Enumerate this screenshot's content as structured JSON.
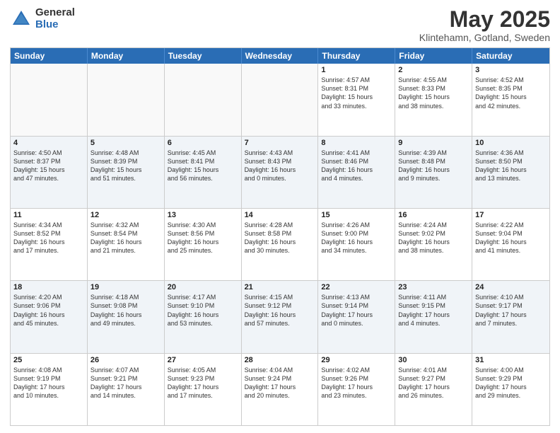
{
  "header": {
    "logo_general": "General",
    "logo_blue": "Blue",
    "title": "May 2025",
    "location": "Klintehamn, Gotland, Sweden"
  },
  "weekdays": [
    "Sunday",
    "Monday",
    "Tuesday",
    "Wednesday",
    "Thursday",
    "Friday",
    "Saturday"
  ],
  "weeks": [
    [
      {
        "day": "",
        "info": "",
        "empty": true
      },
      {
        "day": "",
        "info": "",
        "empty": true
      },
      {
        "day": "",
        "info": "",
        "empty": true
      },
      {
        "day": "",
        "info": "",
        "empty": true
      },
      {
        "day": "1",
        "info": "Sunrise: 4:57 AM\nSunset: 8:31 PM\nDaylight: 15 hours\nand 33 minutes.",
        "empty": false
      },
      {
        "day": "2",
        "info": "Sunrise: 4:55 AM\nSunset: 8:33 PM\nDaylight: 15 hours\nand 38 minutes.",
        "empty": false
      },
      {
        "day": "3",
        "info": "Sunrise: 4:52 AM\nSunset: 8:35 PM\nDaylight: 15 hours\nand 42 minutes.",
        "empty": false
      }
    ],
    [
      {
        "day": "4",
        "info": "Sunrise: 4:50 AM\nSunset: 8:37 PM\nDaylight: 15 hours\nand 47 minutes.",
        "empty": false
      },
      {
        "day": "5",
        "info": "Sunrise: 4:48 AM\nSunset: 8:39 PM\nDaylight: 15 hours\nand 51 minutes.",
        "empty": false
      },
      {
        "day": "6",
        "info": "Sunrise: 4:45 AM\nSunset: 8:41 PM\nDaylight: 15 hours\nand 56 minutes.",
        "empty": false
      },
      {
        "day": "7",
        "info": "Sunrise: 4:43 AM\nSunset: 8:43 PM\nDaylight: 16 hours\nand 0 minutes.",
        "empty": false
      },
      {
        "day": "8",
        "info": "Sunrise: 4:41 AM\nSunset: 8:46 PM\nDaylight: 16 hours\nand 4 minutes.",
        "empty": false
      },
      {
        "day": "9",
        "info": "Sunrise: 4:39 AM\nSunset: 8:48 PM\nDaylight: 16 hours\nand 9 minutes.",
        "empty": false
      },
      {
        "day": "10",
        "info": "Sunrise: 4:36 AM\nSunset: 8:50 PM\nDaylight: 16 hours\nand 13 minutes.",
        "empty": false
      }
    ],
    [
      {
        "day": "11",
        "info": "Sunrise: 4:34 AM\nSunset: 8:52 PM\nDaylight: 16 hours\nand 17 minutes.",
        "empty": false
      },
      {
        "day": "12",
        "info": "Sunrise: 4:32 AM\nSunset: 8:54 PM\nDaylight: 16 hours\nand 21 minutes.",
        "empty": false
      },
      {
        "day": "13",
        "info": "Sunrise: 4:30 AM\nSunset: 8:56 PM\nDaylight: 16 hours\nand 25 minutes.",
        "empty": false
      },
      {
        "day": "14",
        "info": "Sunrise: 4:28 AM\nSunset: 8:58 PM\nDaylight: 16 hours\nand 30 minutes.",
        "empty": false
      },
      {
        "day": "15",
        "info": "Sunrise: 4:26 AM\nSunset: 9:00 PM\nDaylight: 16 hours\nand 34 minutes.",
        "empty": false
      },
      {
        "day": "16",
        "info": "Sunrise: 4:24 AM\nSunset: 9:02 PM\nDaylight: 16 hours\nand 38 minutes.",
        "empty": false
      },
      {
        "day": "17",
        "info": "Sunrise: 4:22 AM\nSunset: 9:04 PM\nDaylight: 16 hours\nand 41 minutes.",
        "empty": false
      }
    ],
    [
      {
        "day": "18",
        "info": "Sunrise: 4:20 AM\nSunset: 9:06 PM\nDaylight: 16 hours\nand 45 minutes.",
        "empty": false
      },
      {
        "day": "19",
        "info": "Sunrise: 4:18 AM\nSunset: 9:08 PM\nDaylight: 16 hours\nand 49 minutes.",
        "empty": false
      },
      {
        "day": "20",
        "info": "Sunrise: 4:17 AM\nSunset: 9:10 PM\nDaylight: 16 hours\nand 53 minutes.",
        "empty": false
      },
      {
        "day": "21",
        "info": "Sunrise: 4:15 AM\nSunset: 9:12 PM\nDaylight: 16 hours\nand 57 minutes.",
        "empty": false
      },
      {
        "day": "22",
        "info": "Sunrise: 4:13 AM\nSunset: 9:14 PM\nDaylight: 17 hours\nand 0 minutes.",
        "empty": false
      },
      {
        "day": "23",
        "info": "Sunrise: 4:11 AM\nSunset: 9:15 PM\nDaylight: 17 hours\nand 4 minutes.",
        "empty": false
      },
      {
        "day": "24",
        "info": "Sunrise: 4:10 AM\nSunset: 9:17 PM\nDaylight: 17 hours\nand 7 minutes.",
        "empty": false
      }
    ],
    [
      {
        "day": "25",
        "info": "Sunrise: 4:08 AM\nSunset: 9:19 PM\nDaylight: 17 hours\nand 10 minutes.",
        "empty": false
      },
      {
        "day": "26",
        "info": "Sunrise: 4:07 AM\nSunset: 9:21 PM\nDaylight: 17 hours\nand 14 minutes.",
        "empty": false
      },
      {
        "day": "27",
        "info": "Sunrise: 4:05 AM\nSunset: 9:23 PM\nDaylight: 17 hours\nand 17 minutes.",
        "empty": false
      },
      {
        "day": "28",
        "info": "Sunrise: 4:04 AM\nSunset: 9:24 PM\nDaylight: 17 hours\nand 20 minutes.",
        "empty": false
      },
      {
        "day": "29",
        "info": "Sunrise: 4:02 AM\nSunset: 9:26 PM\nDaylight: 17 hours\nand 23 minutes.",
        "empty": false
      },
      {
        "day": "30",
        "info": "Sunrise: 4:01 AM\nSunset: 9:27 PM\nDaylight: 17 hours\nand 26 minutes.",
        "empty": false
      },
      {
        "day": "31",
        "info": "Sunrise: 4:00 AM\nSunset: 9:29 PM\nDaylight: 17 hours\nand 29 minutes.",
        "empty": false
      }
    ]
  ]
}
